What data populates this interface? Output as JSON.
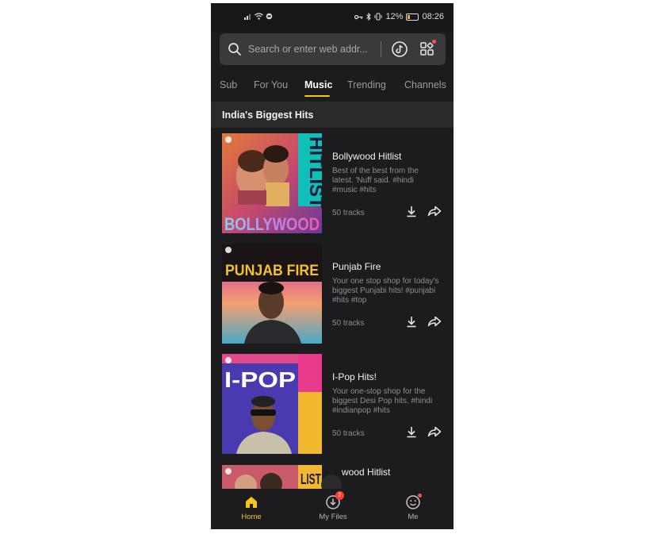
{
  "status_bar": {
    "battery": "12%",
    "time": "08:26"
  },
  "search": {
    "placeholder": "Search or enter web addr..."
  },
  "tabs": [
    {
      "label": "Sub"
    },
    {
      "label": "For You"
    },
    {
      "label": "Music"
    },
    {
      "label": "Trending"
    },
    {
      "label": "Channels"
    }
  ],
  "active_tab": "Music",
  "section": {
    "title": "India's Biggest Hits"
  },
  "playlists": [
    {
      "title": "Bollywood Hitlist",
      "description": "Best of the best from the latest. 'Nuff said. #hindi #music #hits",
      "tracks": "50  tracks",
      "cover_text_main": "BOLLYWOOD",
      "cover_text_side": "HITLIST"
    },
    {
      "title": "Punjab Fire",
      "description": "Your one stop shop for today's biggest Punjabi hits! #punjabi #hits #top",
      "tracks": "50  tracks",
      "cover_text_main": "PUNJAB FIRE"
    },
    {
      "title": "I-Pop Hits!",
      "description": "Your one-stop shop for the biggest Desi Pop hits. #hindi #indianpop #hits",
      "tracks": "50  tracks",
      "cover_text_main": "I-POP"
    },
    {
      "title": "wood Hitlist",
      "cover_text_side": "LIST"
    }
  ],
  "bottom_nav": [
    {
      "label": "Home",
      "icon": "home-icon"
    },
    {
      "label": "My Files",
      "icon": "download-circle-icon",
      "badge": "2"
    },
    {
      "label": "Me",
      "icon": "smiley-icon"
    }
  ],
  "colors": {
    "accent": "#f5c518",
    "background": "#1c1c1e",
    "notification": "#ff3b30"
  }
}
